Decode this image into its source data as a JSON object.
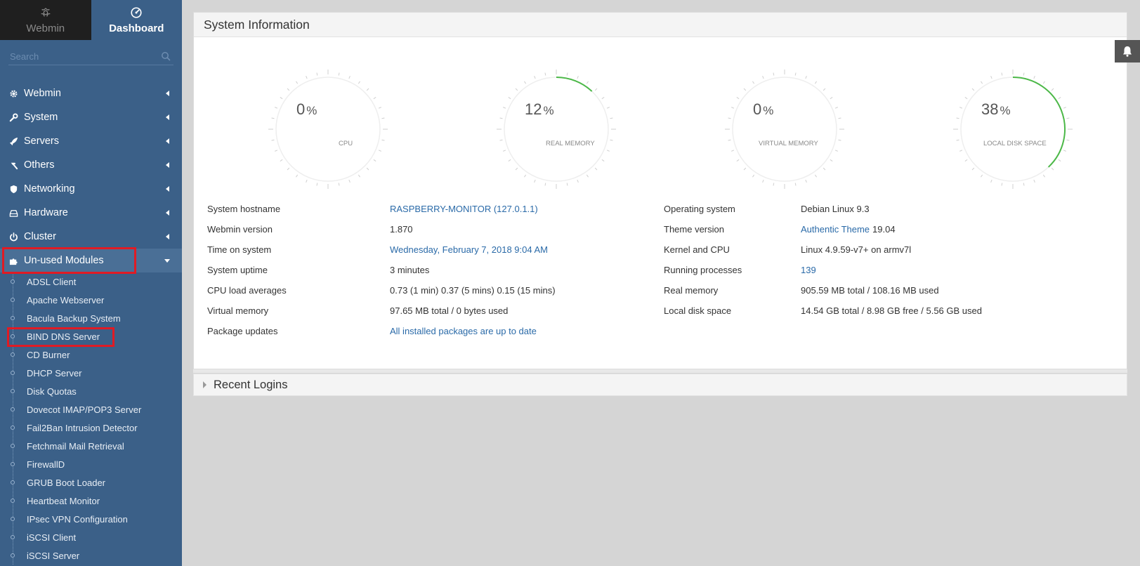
{
  "sidebar": {
    "tabs": [
      {
        "label": "Webmin",
        "icon": "webmin-logo-icon"
      },
      {
        "label": "Dashboard",
        "icon": "dashboard-gauge-icon"
      }
    ],
    "search_placeholder": "Search",
    "menu": [
      {
        "label": "Webmin",
        "icon": "gear-icon"
      },
      {
        "label": "System",
        "icon": "wrench-icon"
      },
      {
        "label": "Servers",
        "icon": "rocket-icon"
      },
      {
        "label": "Others",
        "icon": "hammer-icon"
      },
      {
        "label": "Networking",
        "icon": "shield-icon"
      },
      {
        "label": "Hardware",
        "icon": "drive-icon"
      },
      {
        "label": "Cluster",
        "icon": "power-icon"
      },
      {
        "label": "Un-used Modules",
        "icon": "puzzle-icon"
      }
    ],
    "submenu": [
      "ADSL Client",
      "Apache Webserver",
      "Bacula Backup System",
      "BIND DNS Server",
      "CD Burner",
      "DHCP Server",
      "Disk Quotas",
      "Dovecot IMAP/POP3 Server",
      "Fail2Ban Intrusion Detector",
      "Fetchmail Mail Retrieval",
      "FirewallD",
      "GRUB Boot Loader",
      "Heartbeat Monitor",
      "IPsec VPN Configuration",
      "iSCSI Client",
      "iSCSI Server"
    ]
  },
  "panel": {
    "title": "System Information",
    "gauges": [
      {
        "value": "0",
        "unit": "%",
        "label": "CPU",
        "fraction": 0
      },
      {
        "value": "12",
        "unit": "%",
        "label": "REAL MEMORY",
        "fraction": 0.12
      },
      {
        "value": "0",
        "unit": "%",
        "label": "VIRTUAL MEMORY",
        "fraction": 0
      },
      {
        "value": "38",
        "unit": "%",
        "label": "LOCAL DISK SPACE",
        "fraction": 0.38
      }
    ],
    "left_info": [
      {
        "label": "System hostname",
        "value": "RASPBERRY-MONITOR (127.0.1.1)",
        "link": true
      },
      {
        "label": "Webmin version",
        "value": "1.870",
        "link": false
      },
      {
        "label": "Time on system",
        "value": "Wednesday, February 7, 2018 9:04 AM",
        "link": true
      },
      {
        "label": "System uptime",
        "value": "3 minutes",
        "link": false
      },
      {
        "label": "CPU load averages",
        "value": "0.73 (1 min) 0.37 (5 mins) 0.15 (15 mins)",
        "link": false
      },
      {
        "label": "Virtual memory",
        "value": "97.65 MB total / 0 bytes used",
        "link": false
      },
      {
        "label": "Package updates",
        "value": "All installed packages are up to date",
        "link": true
      }
    ],
    "right_info": [
      {
        "label": "Operating system",
        "value": "Debian Linux 9.3"
      },
      {
        "label": "Theme version",
        "value_link": "Authentic Theme",
        "value": "19.04"
      },
      {
        "label": "Kernel and CPU",
        "value": "Linux 4.9.59-v7+ on armv7l"
      },
      {
        "label": "Running processes",
        "value": "139",
        "link": true
      },
      {
        "label": "Real memory",
        "value": "905.59 MB total / 108.16 MB used"
      },
      {
        "label": "Local disk space",
        "value": "14.54 GB total / 8.98 GB free / 5.56 GB used"
      }
    ]
  },
  "recent_logins": {
    "label": "Recent Logins"
  },
  "colors": {
    "sidebar": "#3b6088",
    "accent_green": "#4cb848",
    "link": "#2a6aa8",
    "highlight": "#e01b24"
  }
}
